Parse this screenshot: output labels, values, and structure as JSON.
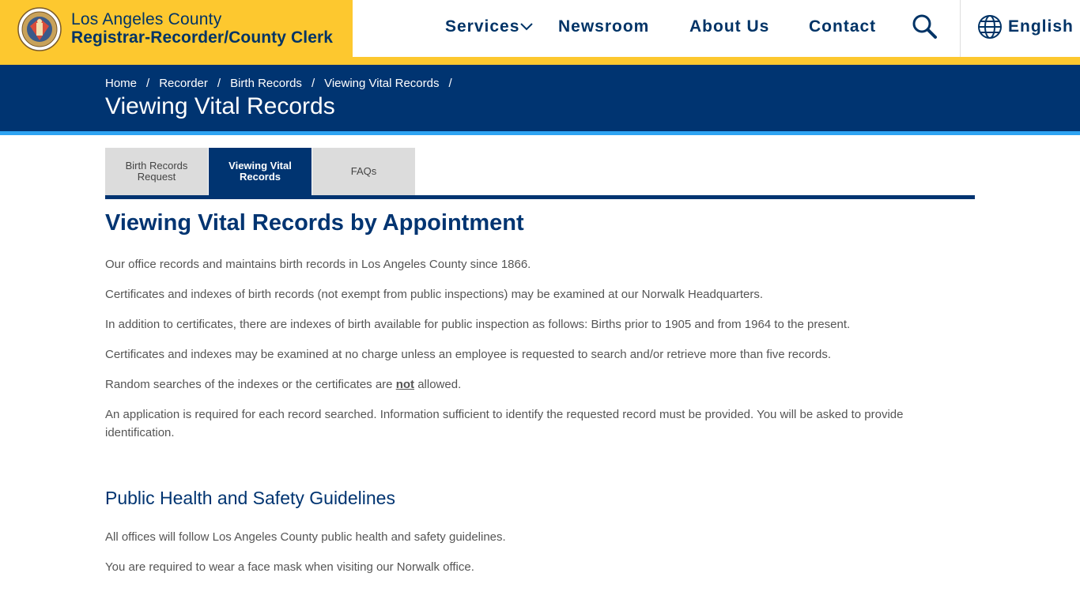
{
  "brand": {
    "line1": "Los Angeles County",
    "line2": "Registrar-Recorder/County Clerk"
  },
  "nav": {
    "services": "Services",
    "newsroom": "Newsroom",
    "about": "About Us",
    "contact": "Contact",
    "language": "English"
  },
  "breadcrumb": [
    "Home",
    "Recorder",
    "Birth Records",
    "Viewing Vital Records"
  ],
  "banner_title": "Viewing Vital Records",
  "tabs": [
    {
      "label_1": "Birth Records",
      "label_2": "Request"
    },
    {
      "label_1": "Viewing Vital",
      "label_2": "Records"
    },
    {
      "label_1": "FAQs",
      "label_2": ""
    }
  ],
  "content": {
    "heading": "Viewing Vital Records by Appointment",
    "p1": "Our office records and maintains birth records in Los Angeles County since 1866.",
    "p2": "Certificates and indexes of birth records (not exempt from public inspections) may be examined at our Norwalk Headquarters.",
    "p3": "In addition to certificates, there are indexes of birth available for public inspection as follows: Births prior to 1905 and from 1964 to the present.",
    "p4": "Certificates and indexes may be examined at no charge unless an employee is requested to search and/or retrieve more than five records.",
    "p5_before": "Random searches of the indexes or the certificates are ",
    "p5_em": "not",
    "p5_after": " allowed.",
    "p6": "An application is required for each record searched. Information sufficient to identify the requested record must be provided. You will be asked to provide identification.",
    "subheading": "Public Health and Safety Guidelines",
    "p7": "All offices will follow Los Angeles County public health and safety guidelines.",
    "p8": "You are required to wear a face mask when visiting our Norwalk office."
  },
  "colors": {
    "gold": "#fdc82f",
    "navy": "#003471",
    "accent_blue": "#2ea3f2"
  },
  "icons": [
    "county-seal-logo",
    "chevron-down-icon",
    "search-icon",
    "globe-icon"
  ]
}
